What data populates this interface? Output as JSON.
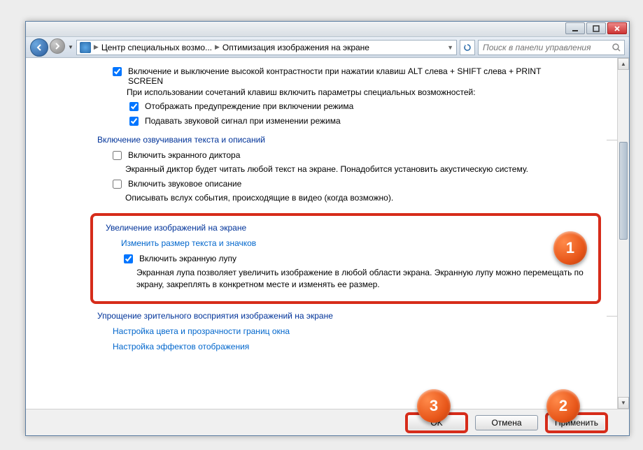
{
  "window": {
    "path_segment1": "Центр специальных возмо...",
    "path_segment2": "Оптимизация изображения на экране",
    "search_placeholder": "Поиск в панели управления"
  },
  "section_contrast": {
    "chk_toggle": "Включение и выключение высокой контрастности при нажатии клавиш ALT слева + SHIFT слева + PRINT SCREEN",
    "sub_note": "При использовании сочетаний клавиш включить параметры специальных возможностей:",
    "chk_warning": "Отображать предупреждение при включении режима",
    "chk_sound": "Подавать звуковой сигнал при изменении режима"
  },
  "section_narrator": {
    "heading": "Включение озвучивания текста и описаний",
    "chk_narrator": "Включить экранного диктора",
    "narrator_desc": "Экранный диктор будет читать любой текст на экране. Понадобится установить акустическую систему.",
    "chk_audio_desc": "Включить звуковое описание",
    "audio_desc_desc": "Описывать вслух события, происходящие в видео (когда возможно)."
  },
  "section_magnify": {
    "heading": "Увеличение изображений на экране",
    "link_resize": "Изменить размер текста и значков",
    "chk_magnifier": "Включить экранную лупу",
    "magnifier_desc": "Экранная лупа позволяет увеличить изображение в любой области экрана. Экранную лупу можно перемещать по экрану, закреплять в конкретном месте и изменять ее размер."
  },
  "section_simplify": {
    "heading": "Упрощение зрительного восприятия изображений на экране",
    "link_color": "Настройка цвета и прозрачности границ окна",
    "link_effects": "Настройка эффектов отображения"
  },
  "footer": {
    "ok": "OK",
    "cancel": "Отмена",
    "apply": "Применить"
  },
  "badges": {
    "b1": "1",
    "b2": "2",
    "b3": "3"
  },
  "checked": {
    "contrast_toggle": true,
    "warning": true,
    "sound": true,
    "narrator": false,
    "audio_desc": false,
    "magnifier": true
  }
}
